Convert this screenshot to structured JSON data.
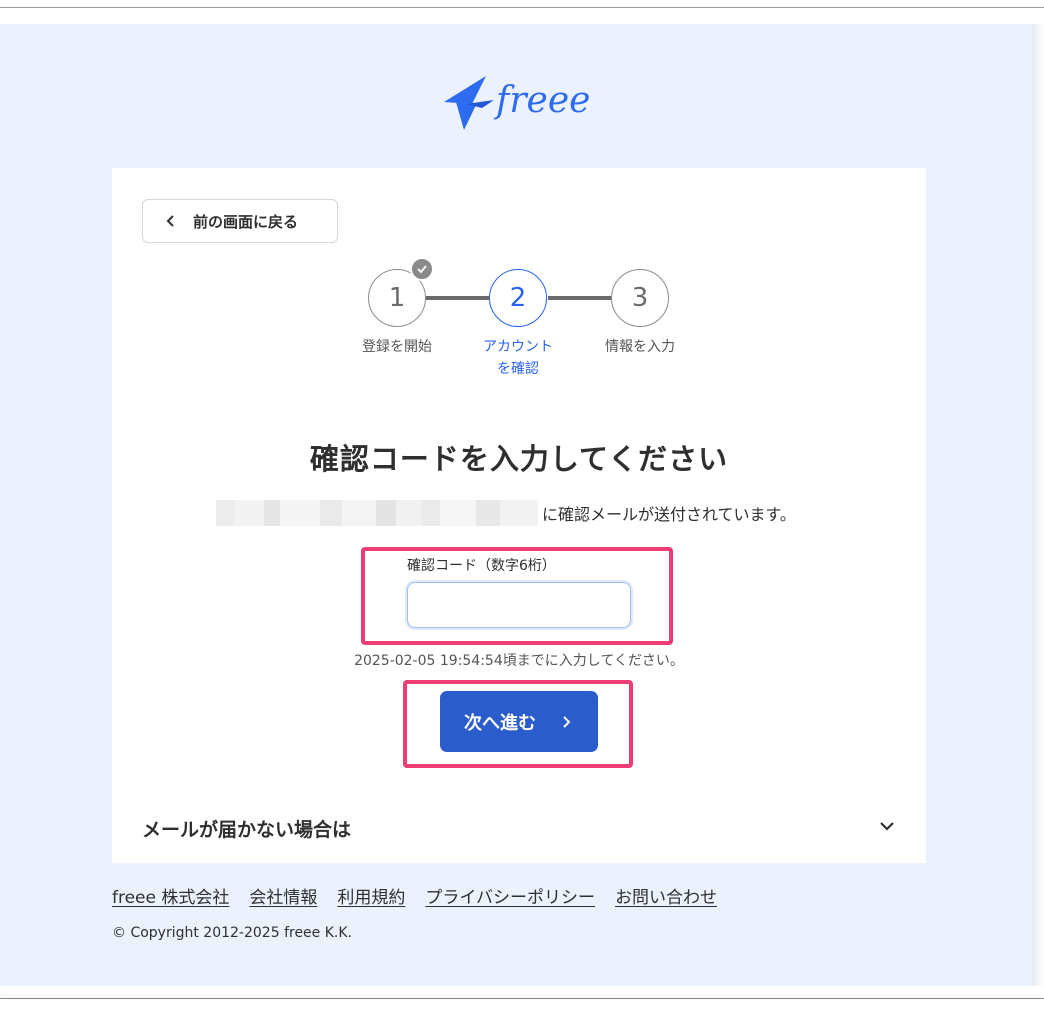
{
  "brand": {
    "logo_text": "freee",
    "accent_color": "#2864f0"
  },
  "back_button": {
    "label": "前の画面に戻る",
    "icon": "chevron-left-icon"
  },
  "stepper": {
    "steps": [
      {
        "number": "1",
        "label": "登録を開始",
        "state": "completed"
      },
      {
        "number": "2",
        "label_line1": "アカウント",
        "label_line2": "を確認",
        "state": "active"
      },
      {
        "number": "3",
        "label": "情報を入力",
        "state": "pending"
      }
    ]
  },
  "main": {
    "heading": "確認コードを入力してください",
    "notice": "に確認メールが送付されています。",
    "code_field": {
      "label": "確認コード（数字6桁）",
      "value": "",
      "placeholder": ""
    },
    "deadline": "2025-02-05 19:54:54頃までに入力してください。",
    "next_button": {
      "label": "次へ進む",
      "color": "#2a5ccb"
    }
  },
  "faq": {
    "title": "メールが届かない場合は",
    "icon": "chevron-down-icon"
  },
  "footer": {
    "links": [
      "freee 株式会社",
      "会社情報",
      "利用規約",
      "プライバシーポリシー",
      "お問い合わせ"
    ],
    "copyright": "© Copyright 2012-2025 freee K.K."
  },
  "highlight_color": "#ec3d74"
}
